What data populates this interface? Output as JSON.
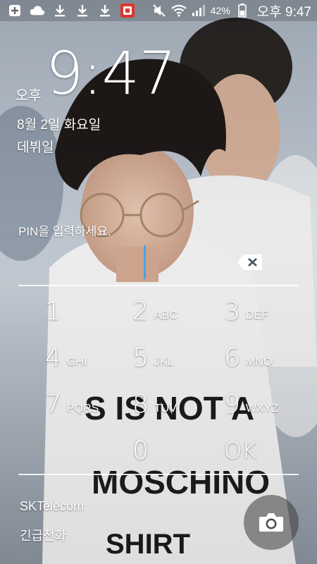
{
  "status_bar": {
    "left_icons": [
      "add-notification-icon",
      "cloud-icon",
      "download-icon",
      "download-icon",
      "download-icon",
      "app-notification-icon"
    ],
    "right_icons": [
      "mute-icon",
      "wifi-icon",
      "signal-icon",
      "battery-icon"
    ],
    "battery_percent": "42%",
    "time": "오후 9:47"
  },
  "lock_screen": {
    "ampm": "오후",
    "time": "9:47",
    "date": "8월 2일 화요일",
    "owner_info": "데뷔일"
  },
  "pin": {
    "prompt": "PIN을 입력하세요.",
    "value": "",
    "cursor_color": "#4aa3e8"
  },
  "keypad": {
    "rows": [
      [
        {
          "num": "1",
          "letters": ""
        },
        {
          "num": "2",
          "letters": "ABC"
        },
        {
          "num": "3",
          "letters": "DEF"
        }
      ],
      [
        {
          "num": "4",
          "letters": "GHI"
        },
        {
          "num": "5",
          "letters": "JKL"
        },
        {
          "num": "6",
          "letters": "MNO"
        }
      ],
      [
        {
          "num": "7",
          "letters": "PQRS"
        },
        {
          "num": "8",
          "letters": "TUV"
        },
        {
          "num": "9",
          "letters": "WXYZ"
        }
      ],
      [
        {
          "num": "",
          "letters": ""
        },
        {
          "num": "0",
          "letters": ""
        },
        {
          "num": "OK",
          "letters": ""
        }
      ]
    ]
  },
  "bottom": {
    "carrier": "SKTelecom",
    "emergency_call": "긴급전화",
    "camera_icon": "camera-icon"
  },
  "wallpaper": {
    "shirt_text": [
      "S IS NOT A",
      "MOSCHINO",
      "SHIRT"
    ]
  }
}
